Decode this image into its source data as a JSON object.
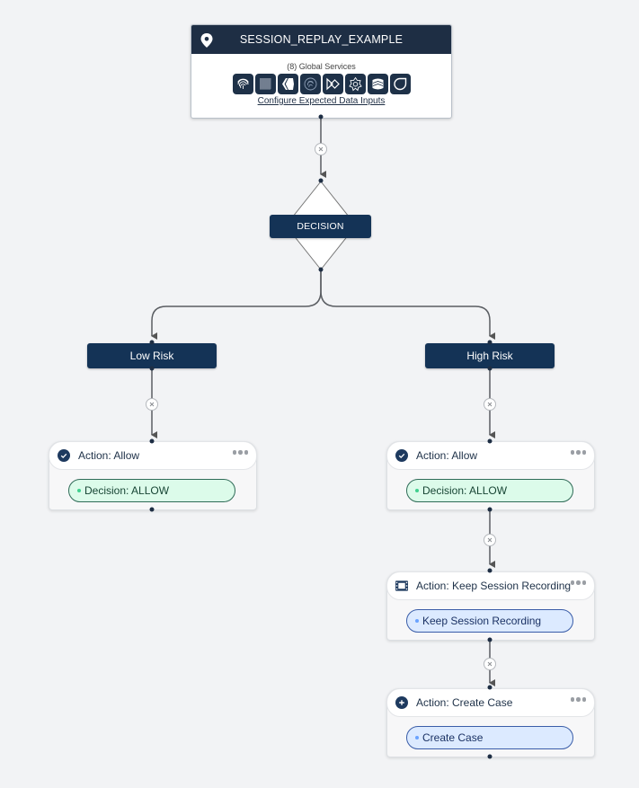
{
  "start": {
    "icon": "map-pin-icon",
    "title": "SESSION_REPLAY_EXAMPLE",
    "services_count_label": "(8) Global Services",
    "services": [
      {
        "name": "fingerprint-service"
      },
      {
        "name": "grid-service"
      },
      {
        "name": "chevron-hexagon-service"
      },
      {
        "name": "fingerprint-badge-service"
      },
      {
        "name": "bowtie-service"
      },
      {
        "name": "gear-star-service"
      },
      {
        "name": "stacked-chevron-service"
      },
      {
        "name": "leaf-service"
      }
    ],
    "configure_link": "Configure Expected Data Inputs"
  },
  "decision": {
    "label": "DECISION"
  },
  "branches": {
    "low": {
      "label": "Low Risk"
    },
    "high": {
      "label": "High Risk"
    }
  },
  "actions": [
    {
      "branch": "Low Risk",
      "icon": "check-circle-icon",
      "title": "Action: Allow",
      "pill": "Decision: ALLOW",
      "pill_style": "green"
    },
    {
      "branch": "High Risk",
      "icon": "check-circle-icon",
      "title": "Action: Allow",
      "pill": "Decision: ALLOW",
      "pill_style": "green"
    },
    {
      "branch": "High Risk",
      "icon": "film-icon",
      "title": "Action: Keep Session Recording",
      "pill": "Keep Session Recording",
      "pill_style": "blue"
    },
    {
      "branch": "High Risk",
      "icon": "plus-circle-icon",
      "title": "Action: Create Case",
      "pill": "Create Case",
      "pill_style": "blue"
    }
  ],
  "colors": {
    "header_bg": "#1e2e44",
    "node_bg": "#143356",
    "allow_pill_bg": "#dcfbea",
    "info_pill_bg": "#dceaff",
    "canvas_bg": "#f2f3f5"
  }
}
